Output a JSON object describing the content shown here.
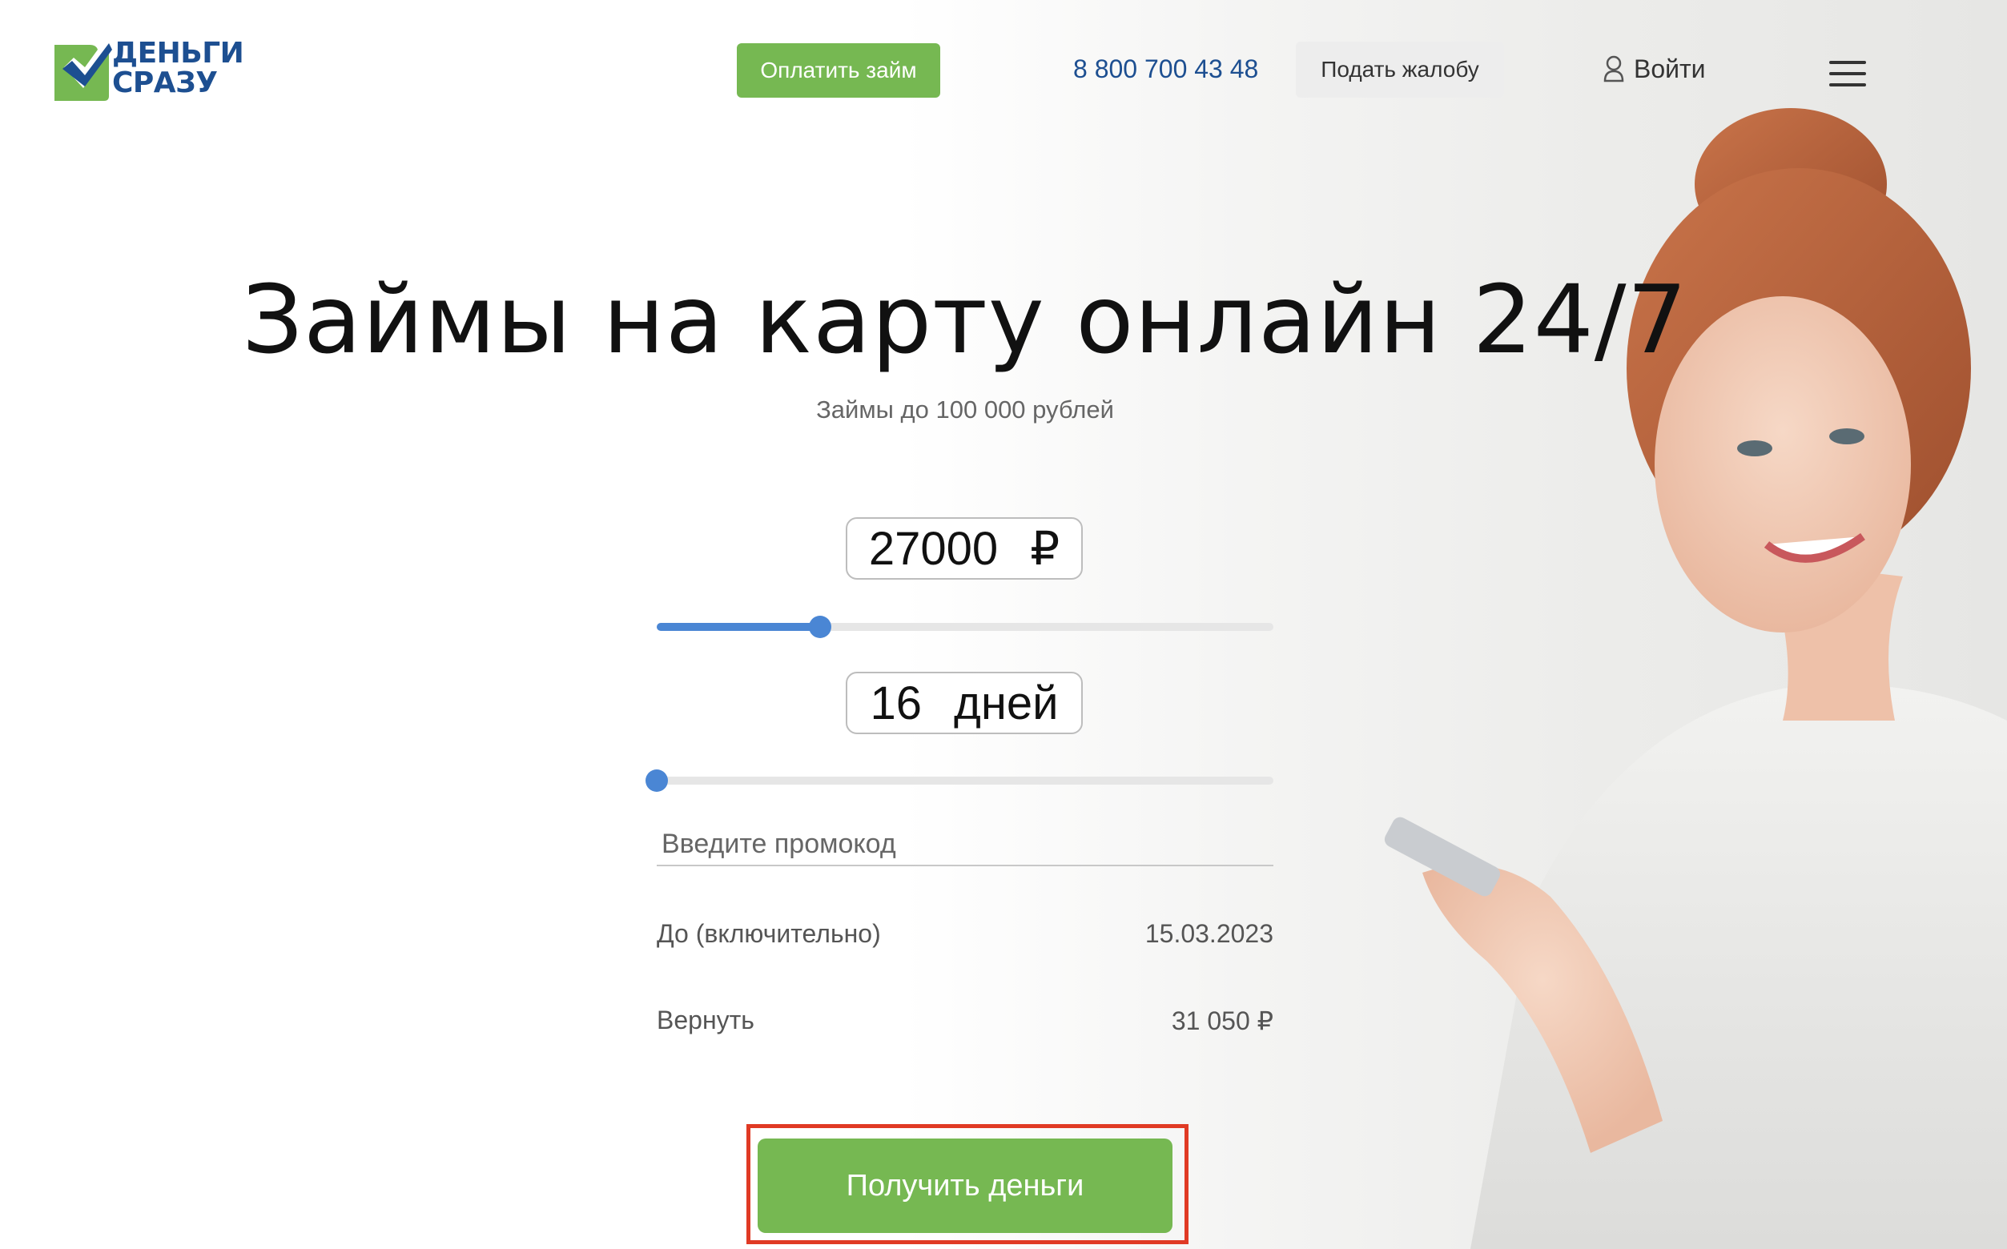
{
  "header": {
    "logo_line1": "ДЕНЬГИ",
    "logo_line2": "СРАЗУ",
    "pay_button": "Оплатить займ",
    "phone": "8 800 700 43 48",
    "complaint_button": "Подать жалобу",
    "login_label": "Войти",
    "menu_icon": "hamburger-menu-icon"
  },
  "hero": {
    "title": "Займы на карту онлайн 24/7",
    "subtitle": "Займы до 100 000 рублей"
  },
  "calculator": {
    "amount": {
      "value": "27000",
      "unit": "₽",
      "slider_fraction": 0.265
    },
    "term": {
      "value": "16",
      "unit": "дней",
      "slider_fraction": 0.0
    },
    "promo_placeholder": "Введите промокод",
    "due_label": "До (включительно)",
    "due_value": "15.03.2023",
    "repay_label": "Вернуть",
    "repay_value": "31 050 ₽",
    "submit_button": "Получить деньги"
  },
  "colors": {
    "accent_green": "#76b852",
    "brand_blue": "#1d4f91",
    "slider_blue": "#4a86d4",
    "highlight_red": "#e03a24"
  }
}
